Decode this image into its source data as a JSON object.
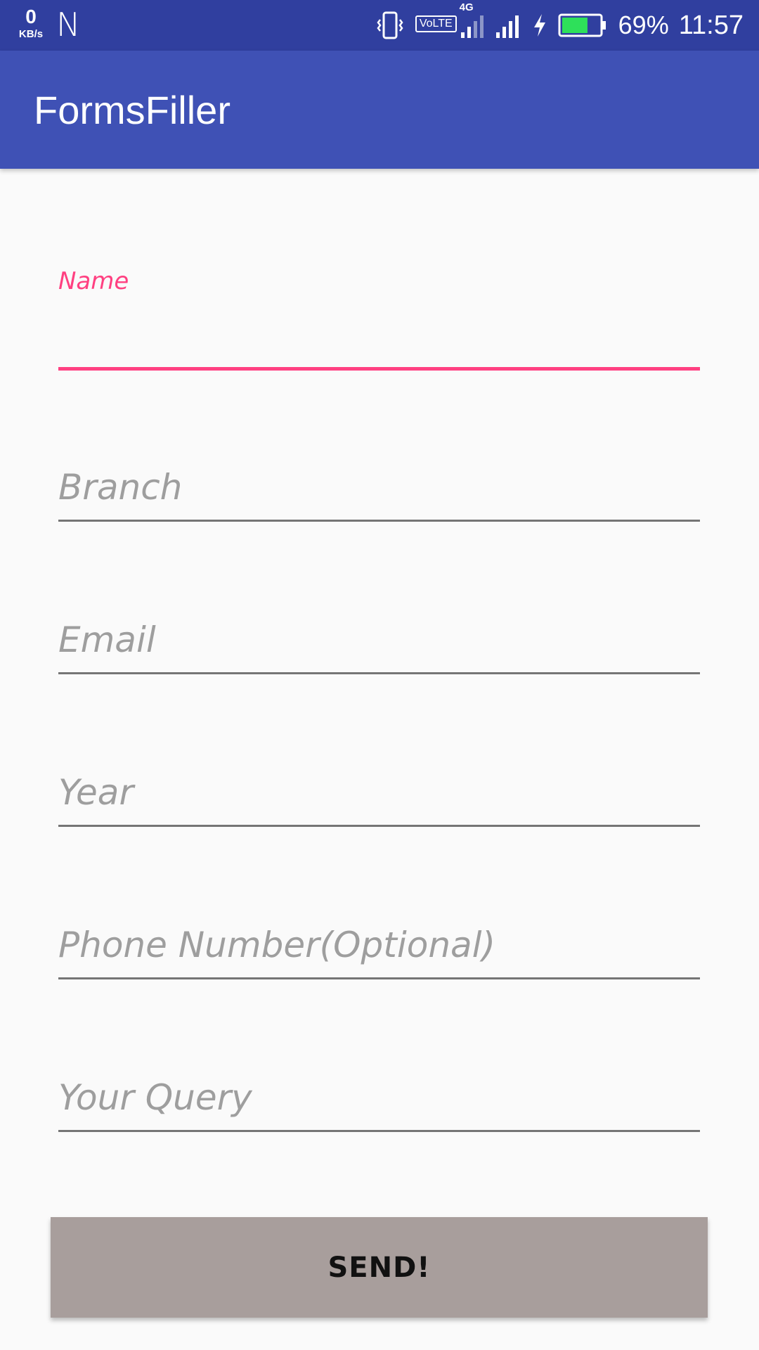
{
  "status_bar": {
    "net_speed_value": "0",
    "net_speed_unit": "KB/s",
    "notification_letter": "N",
    "volte_label": "VoLTE",
    "network_type": "4G",
    "battery_percent": "69%",
    "battery_level": 0.69,
    "battery_color": "#2ee05a",
    "time": "11:57",
    "icons": [
      "vibrate-icon",
      "volte-icon",
      "signal-4g-icon",
      "signal-icon",
      "charging-icon",
      "battery-icon"
    ]
  },
  "app_bar": {
    "title": "FormsFiller",
    "color": "#3f51b5"
  },
  "form": {
    "accent_color": "#ff4081",
    "name_label": "Name",
    "name_value": "",
    "branch_hint": "Branch",
    "email_hint": "Email",
    "year_hint": "Year",
    "phone_hint": "Phone Number(Optional)",
    "query_hint": "Your Query",
    "send_label": "SEND!"
  }
}
